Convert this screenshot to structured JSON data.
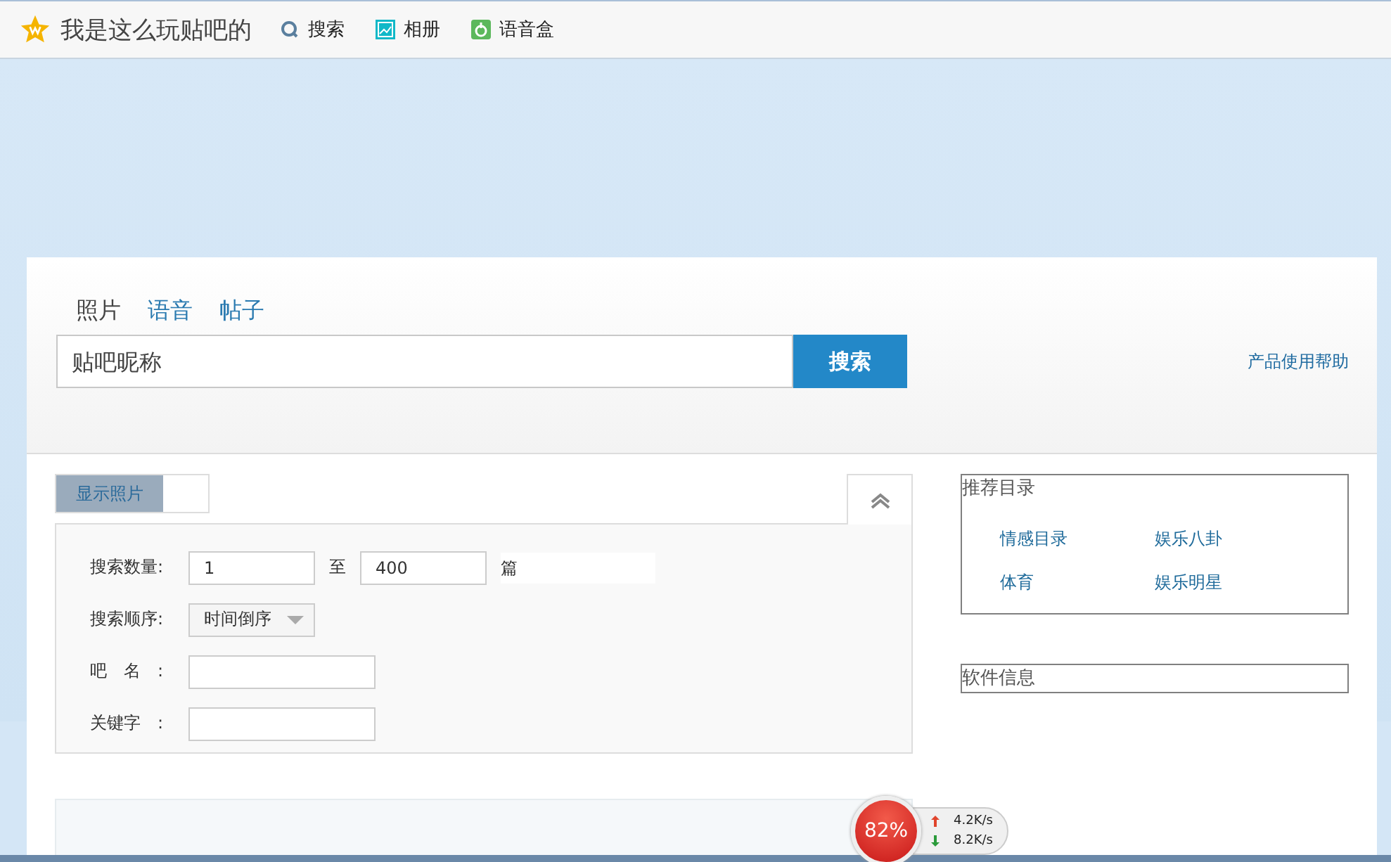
{
  "app": {
    "title": "我是这么玩贴吧的",
    "nav": [
      {
        "label": "搜索",
        "kind": "search"
      },
      {
        "label": "相册",
        "kind": "album"
      },
      {
        "label": "语音盒",
        "kind": "voice"
      }
    ]
  },
  "search": {
    "tabs": [
      {
        "label": "照片",
        "selected": true
      },
      {
        "label": "语音",
        "selected": false
      },
      {
        "label": "帖子",
        "selected": false
      }
    ],
    "placeholder": "贴吧昵称",
    "button": "搜索",
    "help_link": "产品使用帮助"
  },
  "options": {
    "toggle": {
      "label": "显示照片",
      "on": true
    },
    "count": {
      "label": "搜索数量:",
      "from": "1",
      "sep": "至",
      "to": "400",
      "unit": "篇"
    },
    "order": {
      "label": "搜索顺序:",
      "value": "时间倒序"
    },
    "bar_name": {
      "label": "吧　名　:"
    },
    "keyword": {
      "label": "关键字　:"
    }
  },
  "recommend": {
    "title": "推荐目录",
    "links": [
      "情感目录",
      "娱乐八卦",
      "体育",
      "娱乐明星"
    ]
  },
  "software": {
    "title": "软件信息"
  },
  "net_widget": {
    "percent": "82%",
    "up": "4.2K/s",
    "down": "8.2K/s"
  }
}
